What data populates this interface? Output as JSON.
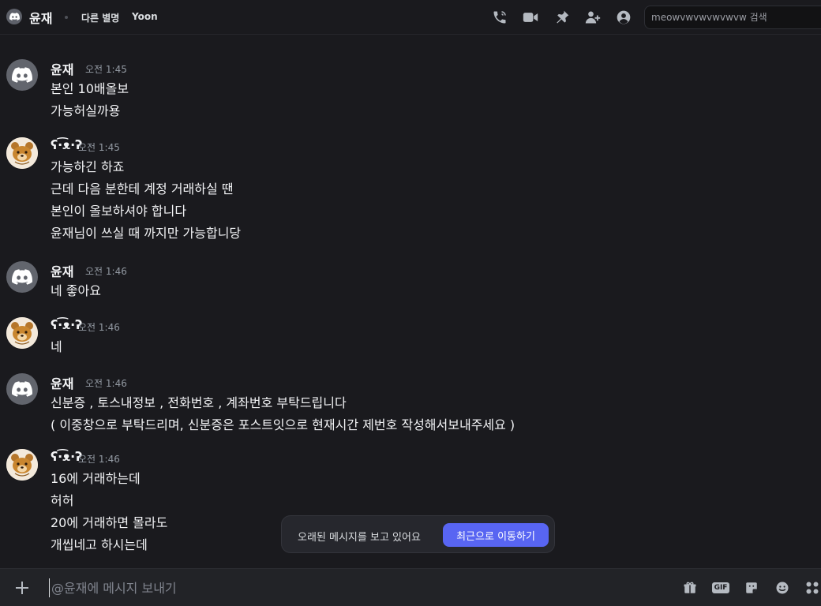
{
  "header": {
    "name": "윤재",
    "alias_label": "다른 별명",
    "alias_value": "Yoon",
    "search_placeholder": "meowvwvwvwvwvw 검색"
  },
  "messages": [
    {
      "author": "윤재",
      "time": "오전 1:45",
      "avatar": "discord",
      "lines": [
        "본인 10배올보",
        "가능허실까용"
      ]
    },
    {
      "author": "ʕ·͡ᴥ·ʔ",
      "time": "오전 1:45",
      "avatar": "bear",
      "lines": [
        "가능하긴 하죠",
        "근데 다음 분한테 계정 거래하실 땐",
        "본인이 올보하셔야 합니다",
        "윤재님이 쓰실 때 까지만 가능합니당"
      ]
    },
    {
      "author": "윤재",
      "time": "오전 1:46",
      "avatar": "discord",
      "lines": [
        "네 좋아요"
      ]
    },
    {
      "author": "ʕ·͡ᴥ·ʔ",
      "time": "오전 1:46",
      "avatar": "bear",
      "lines": [
        "네"
      ]
    },
    {
      "author": "윤재",
      "time": "오전 1:46",
      "avatar": "discord",
      "lines": [
        "신분증 , 토스내정보 , 전화번호 , 계좌번호 부탁드립니다",
        "( 이중창으로 부탁드리며, 신분증은 포스트잇으로 현재시간 제번호 작성해서보내주세요 )"
      ]
    },
    {
      "author": "ʕ·͡ᴥ·ʔ",
      "time": "오전 1:46",
      "avatar": "bear",
      "lines": [
        "16에 거래하는데",
        "허허",
        "20에 거래하면 몰라도",
        "개씹네고 하시는데"
      ]
    }
  ],
  "jump_banner": {
    "text": "오래된 메시지를 보고 있어요",
    "button": "최근으로 이동하기"
  },
  "composer": {
    "placeholder": "@윤재에 메시지 보내기",
    "gif_label": "GIF"
  },
  "colors": {
    "background": "#1a1a1e",
    "accent": "#5865f2",
    "muted": "#949ba4"
  }
}
